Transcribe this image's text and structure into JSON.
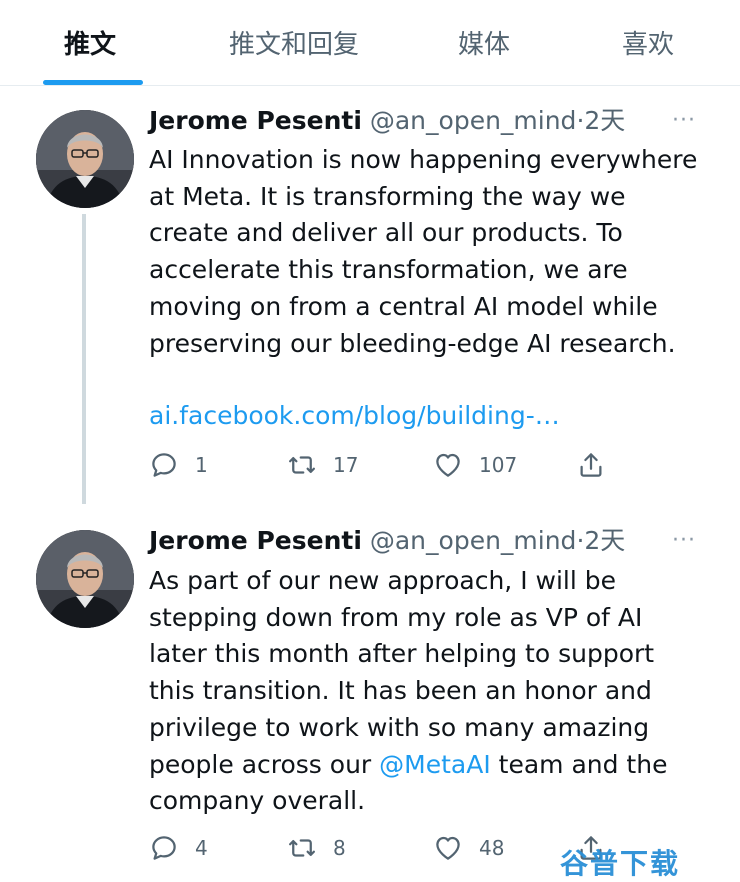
{
  "tabs": [
    {
      "label": "推文",
      "active": true
    },
    {
      "label": "推文和回复",
      "active": false
    },
    {
      "label": "媒体",
      "active": false
    },
    {
      "label": "喜欢",
      "active": false
    }
  ],
  "colors": {
    "accent": "#1d9bf0",
    "muted": "#536471",
    "text": "#0f1419"
  },
  "tweets": [
    {
      "name": "Jerome Pesenti",
      "handle": "@an_open_mind",
      "sep": "·",
      "time": "2天",
      "more": "···",
      "text_lines": [
        "AI Innovation is now happening everywhere",
        "at Meta. It is transforming the way we",
        "create and deliver all our products. To",
        "accelerate this transformation, we are",
        "moving on from a central AI model while",
        "preserving our bleeding-edge AI research."
      ],
      "link": "ai.facebook.com/blog/building-…",
      "replies": "1",
      "retweets": "17",
      "likes": "107"
    },
    {
      "name": "Jerome Pesenti",
      "handle": "@an_open_mind",
      "sep": "·",
      "time": "2天",
      "more": "···",
      "text_lines": [
        "As part of our new approach, I will be",
        "stepping down from my role as VP of AI",
        "later this month after helping to support",
        "this transition. It has been an honor and",
        "privilege to work with so many amazing"
      ],
      "line6_before": "people across our ",
      "mention": "@MetaAI",
      "line6_after": " team and the",
      "line7": "company overall.",
      "replies": "4",
      "retweets": "8",
      "likes": "48"
    }
  ],
  "icons": [
    "reply-icon",
    "retweet-icon",
    "like-icon",
    "share-icon",
    "more-icon"
  ],
  "watermark": "谷普下载"
}
